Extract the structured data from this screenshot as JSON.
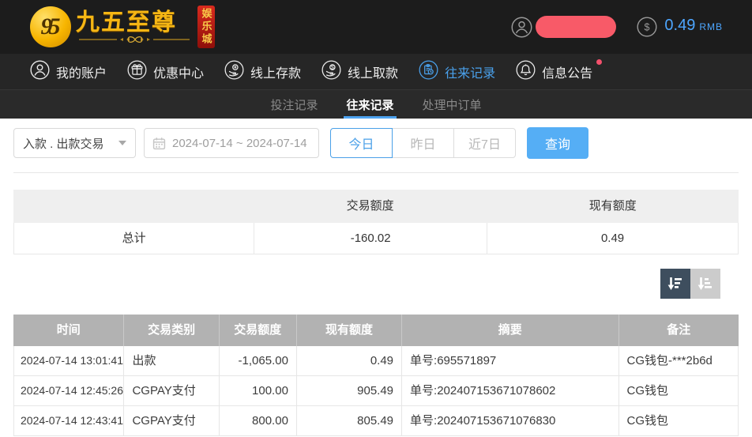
{
  "topbar": {
    "logo_monogram": "95",
    "logo_title": "九五至尊",
    "logo_badge": "娱乐城",
    "balance_amount": "0.49",
    "balance_currency": "RMB"
  },
  "nav": {
    "items": [
      {
        "name": "my-account",
        "icon": "user-icon",
        "label": "我的账户",
        "active": false,
        "dot": false
      },
      {
        "name": "promotions",
        "icon": "gift-icon",
        "label": "优惠中心",
        "active": false,
        "dot": false
      },
      {
        "name": "online-deposit",
        "icon": "deposit-icon",
        "label": "线上存款",
        "active": false,
        "dot": false
      },
      {
        "name": "online-withdrawal",
        "icon": "withdraw-icon",
        "label": "线上取款",
        "active": false,
        "dot": false
      },
      {
        "name": "transaction-records",
        "icon": "records-icon",
        "label": "往来记录",
        "active": true,
        "dot": false
      },
      {
        "name": "announcements",
        "icon": "bell-icon",
        "label": "信息公告",
        "active": false,
        "dot": true
      }
    ]
  },
  "subnav": {
    "tabs": [
      {
        "name": "bet-records",
        "label": "投注记录",
        "active": false
      },
      {
        "name": "transaction-records",
        "label": "往来记录",
        "active": true
      },
      {
        "name": "processing-orders",
        "label": "处理中订单",
        "active": false
      }
    ]
  },
  "filters": {
    "type_value": "入款 . 出款交易",
    "date_range": "2024-07-14 ~ 2024-07-14",
    "quick": [
      "今日",
      "昨日",
      "近7日"
    ],
    "quick_active": 0,
    "search_label": "查询"
  },
  "summary": {
    "col_transaction": "交易额度",
    "col_balance": "现有额度",
    "row_label": "总计",
    "transaction_total": "-160.02",
    "balance_total": "0.49"
  },
  "table": {
    "columns": [
      "时间",
      "交易类别",
      "交易额度",
      "现有额度",
      "摘要",
      "备注"
    ],
    "rows": [
      [
        "2024-07-14 13:01:41",
        "出款",
        "-1,065.00",
        "0.49",
        "单号:695571897",
        "CG钱包-***2b6d"
      ],
      [
        "2024-07-14 12:45:26",
        "CGPAY支付",
        "100.00",
        "905.49",
        "单号:202407153671078602",
        "CG钱包"
      ],
      [
        "2024-07-14 12:43:41",
        "CGPAY支付",
        "800.00",
        "805.49",
        "单号:202407153671076830",
        "CG钱包"
      ]
    ]
  },
  "colors": {
    "accent_blue": "#4da3f0",
    "query_button": "#55aef5",
    "balance_text": "#4da6ff",
    "gold": "#f5b614",
    "badge_red": "#c2211a",
    "redaction_pill": "#f85a68",
    "notification_dot": "#f4506c",
    "table_header_bg": "#b2b2b2",
    "sort_active_bg": "#3e4e5e",
    "sort_inactive_bg": "#cccccc"
  }
}
